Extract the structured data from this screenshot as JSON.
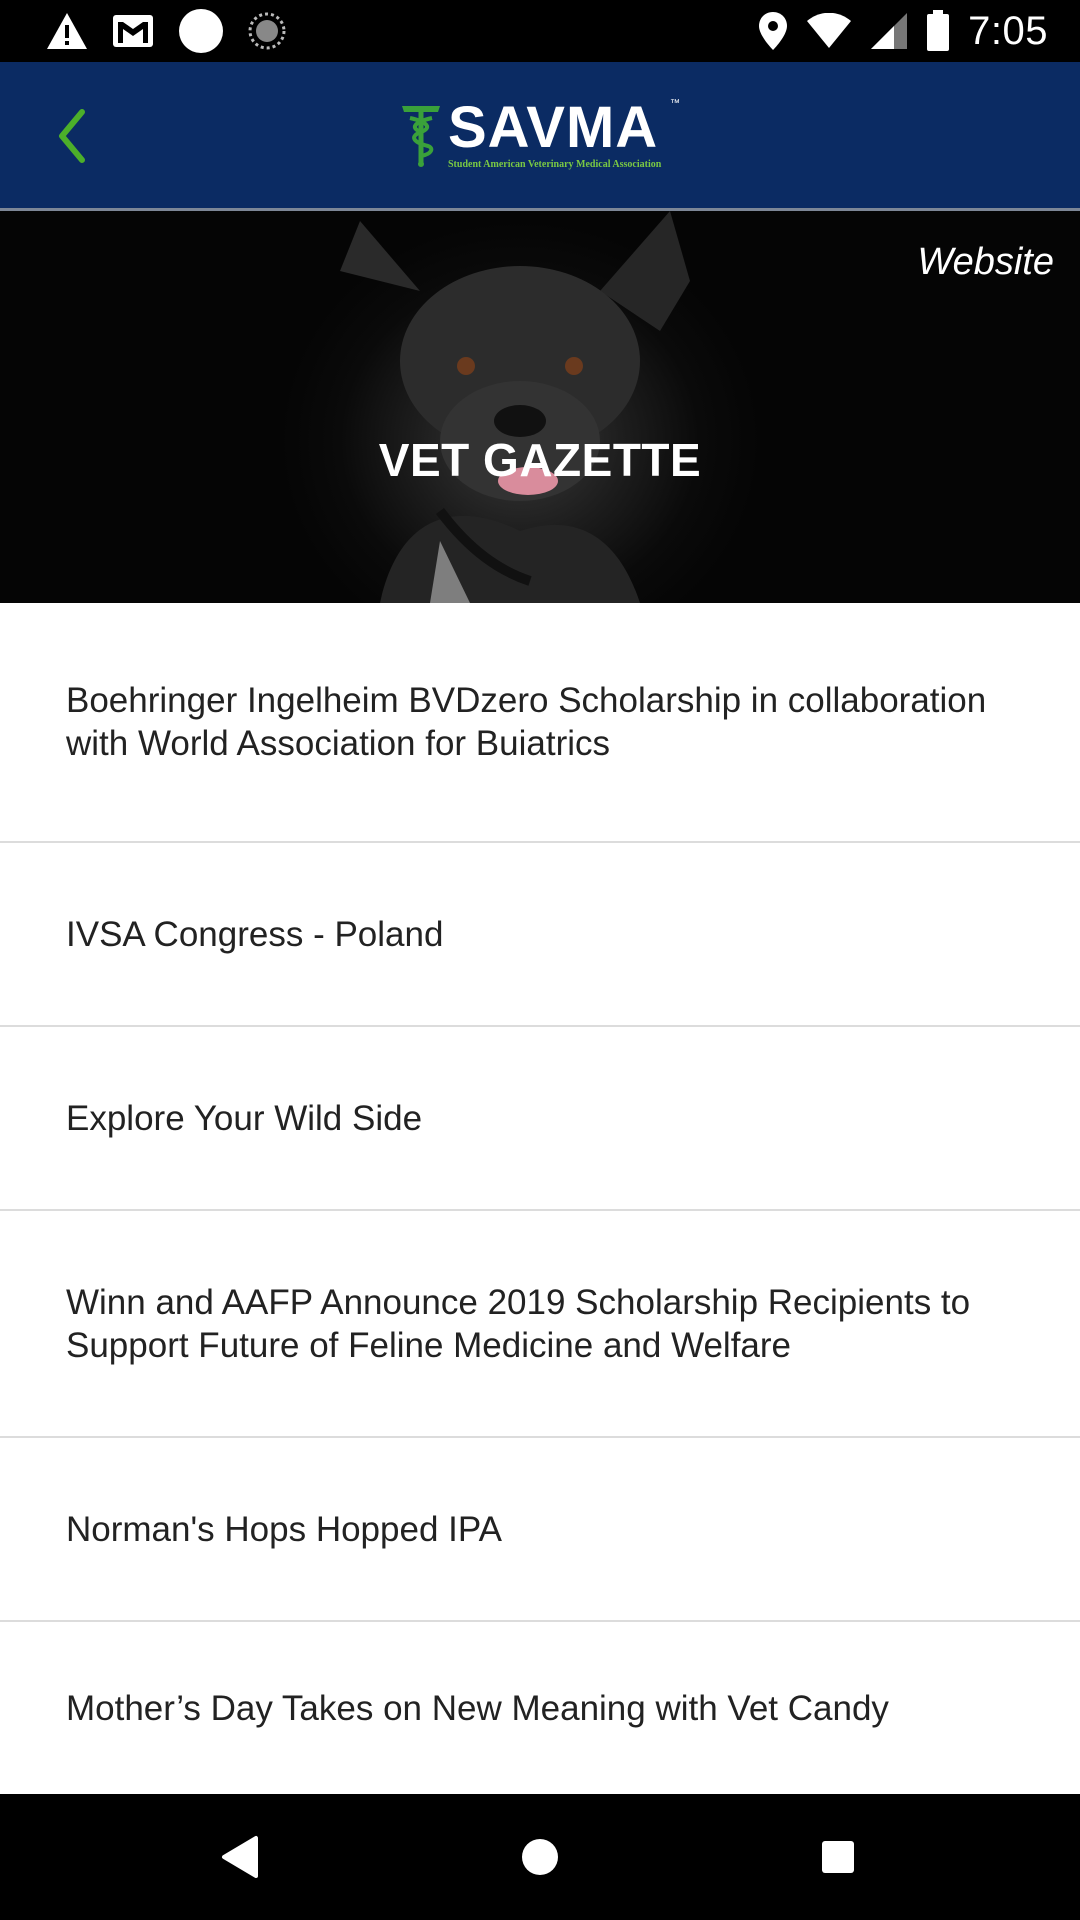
{
  "status_bar": {
    "time": "7:05",
    "left_icons": [
      "warning-icon",
      "gmail-icon",
      "circle-icon",
      "sync-icon"
    ],
    "right_icons": [
      "location-icon",
      "wifi-icon",
      "signal-icon",
      "battery-icon"
    ]
  },
  "app_bar": {
    "back_icon": "chevron-left-icon",
    "logo_text": "SAVMA",
    "logo_tm": "™",
    "logo_subtitle": "Student American Veterinary Medical Association",
    "accent_color": "#7ac943",
    "background_color": "#0b2b63"
  },
  "hero": {
    "website_label": "Website",
    "title": "VET GAZETTE"
  },
  "articles": [
    {
      "title": "Boehringer Ingelheim BVDzero Scholarship in collaboration with World Association for Buiatrics"
    },
    {
      "title": "IVSA Congress - Poland"
    },
    {
      "title": "Explore Your Wild Side"
    },
    {
      "title": "Winn and AAFP Announce 2019 Scholarship Recipients to Support Future of Feline Medicine and Welfare"
    },
    {
      "title": "Norman's Hops Hopped IPA"
    },
    {
      "title": "Mother’s Day Takes on New Meaning with Vet Candy"
    }
  ],
  "nav_bar": {
    "buttons": [
      "back-triangle-icon",
      "home-circle-icon",
      "recents-square-icon"
    ]
  }
}
